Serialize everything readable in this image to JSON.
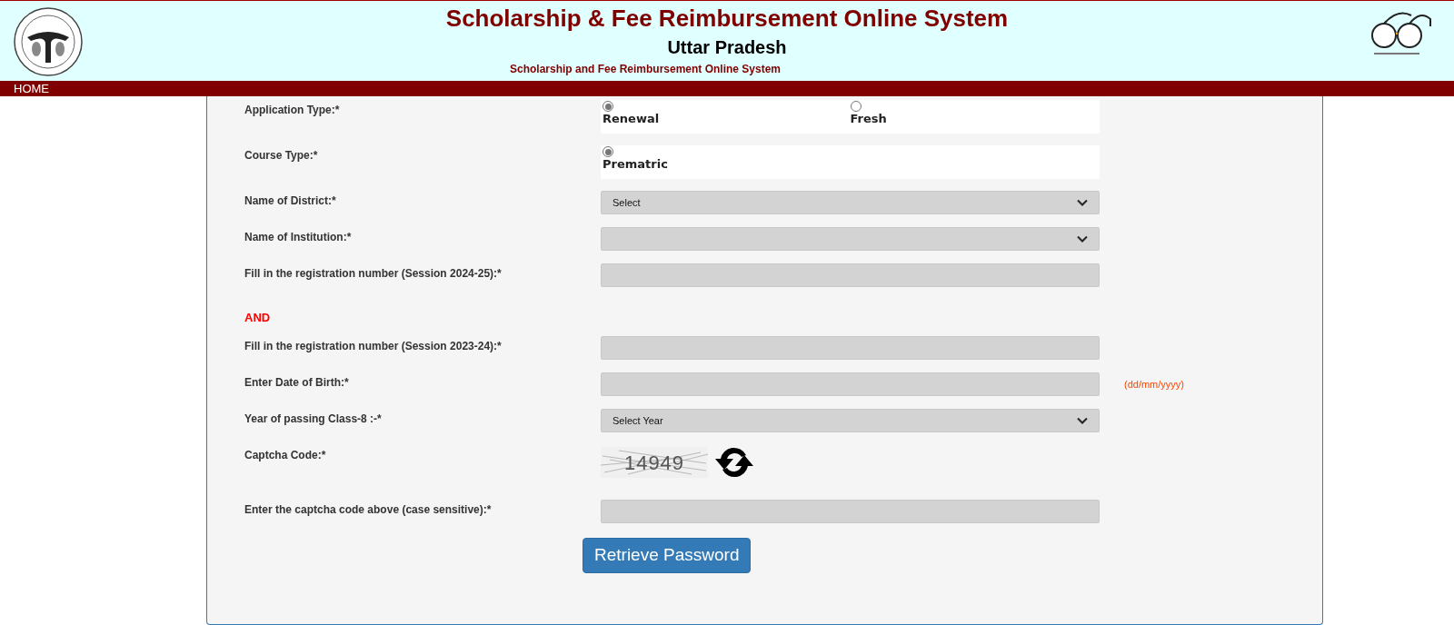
{
  "header": {
    "title": "Scholarship & Fee Reimbursement Online System",
    "state": "Uttar Pradesh",
    "subtitle": "Scholarship and Fee Reimbursement Online System"
  },
  "nav": {
    "items": [
      "HOME"
    ]
  },
  "form": {
    "rows": [
      {
        "kind": "radio",
        "label": "Application Type:*",
        "options": [
          {
            "label": "Renewal",
            "selected": true
          },
          {
            "label": "Fresh",
            "selected": false
          }
        ]
      },
      {
        "kind": "radio",
        "label": "Course Type:*",
        "options": [
          {
            "label": "Prematric",
            "selected": true
          }
        ]
      },
      {
        "kind": "select",
        "label": "Name of District:*",
        "value": "Select"
      },
      {
        "kind": "select",
        "label": "Name of Institution:*"
      },
      {
        "kind": "input",
        "label": "Fill in the registration number (Session 2024-25):*"
      },
      {
        "kind": "separator",
        "label": "AND"
      },
      {
        "kind": "input",
        "label": "Fill in the registration number (Session 2023-24):*"
      },
      {
        "kind": "input",
        "label": "Enter Date of Birth:*",
        "hint": "(dd/mm/yyyy)"
      },
      {
        "kind": "select",
        "label": "Year of passing Class-8 :-*",
        "value": "Select Year"
      },
      {
        "kind": "captcha",
        "label": "Captcha Code:*",
        "code": "14949"
      },
      {
        "kind": "input",
        "label": "Enter the captcha code above (case sensitive):*"
      }
    ],
    "submit": "Retrieve Password"
  }
}
